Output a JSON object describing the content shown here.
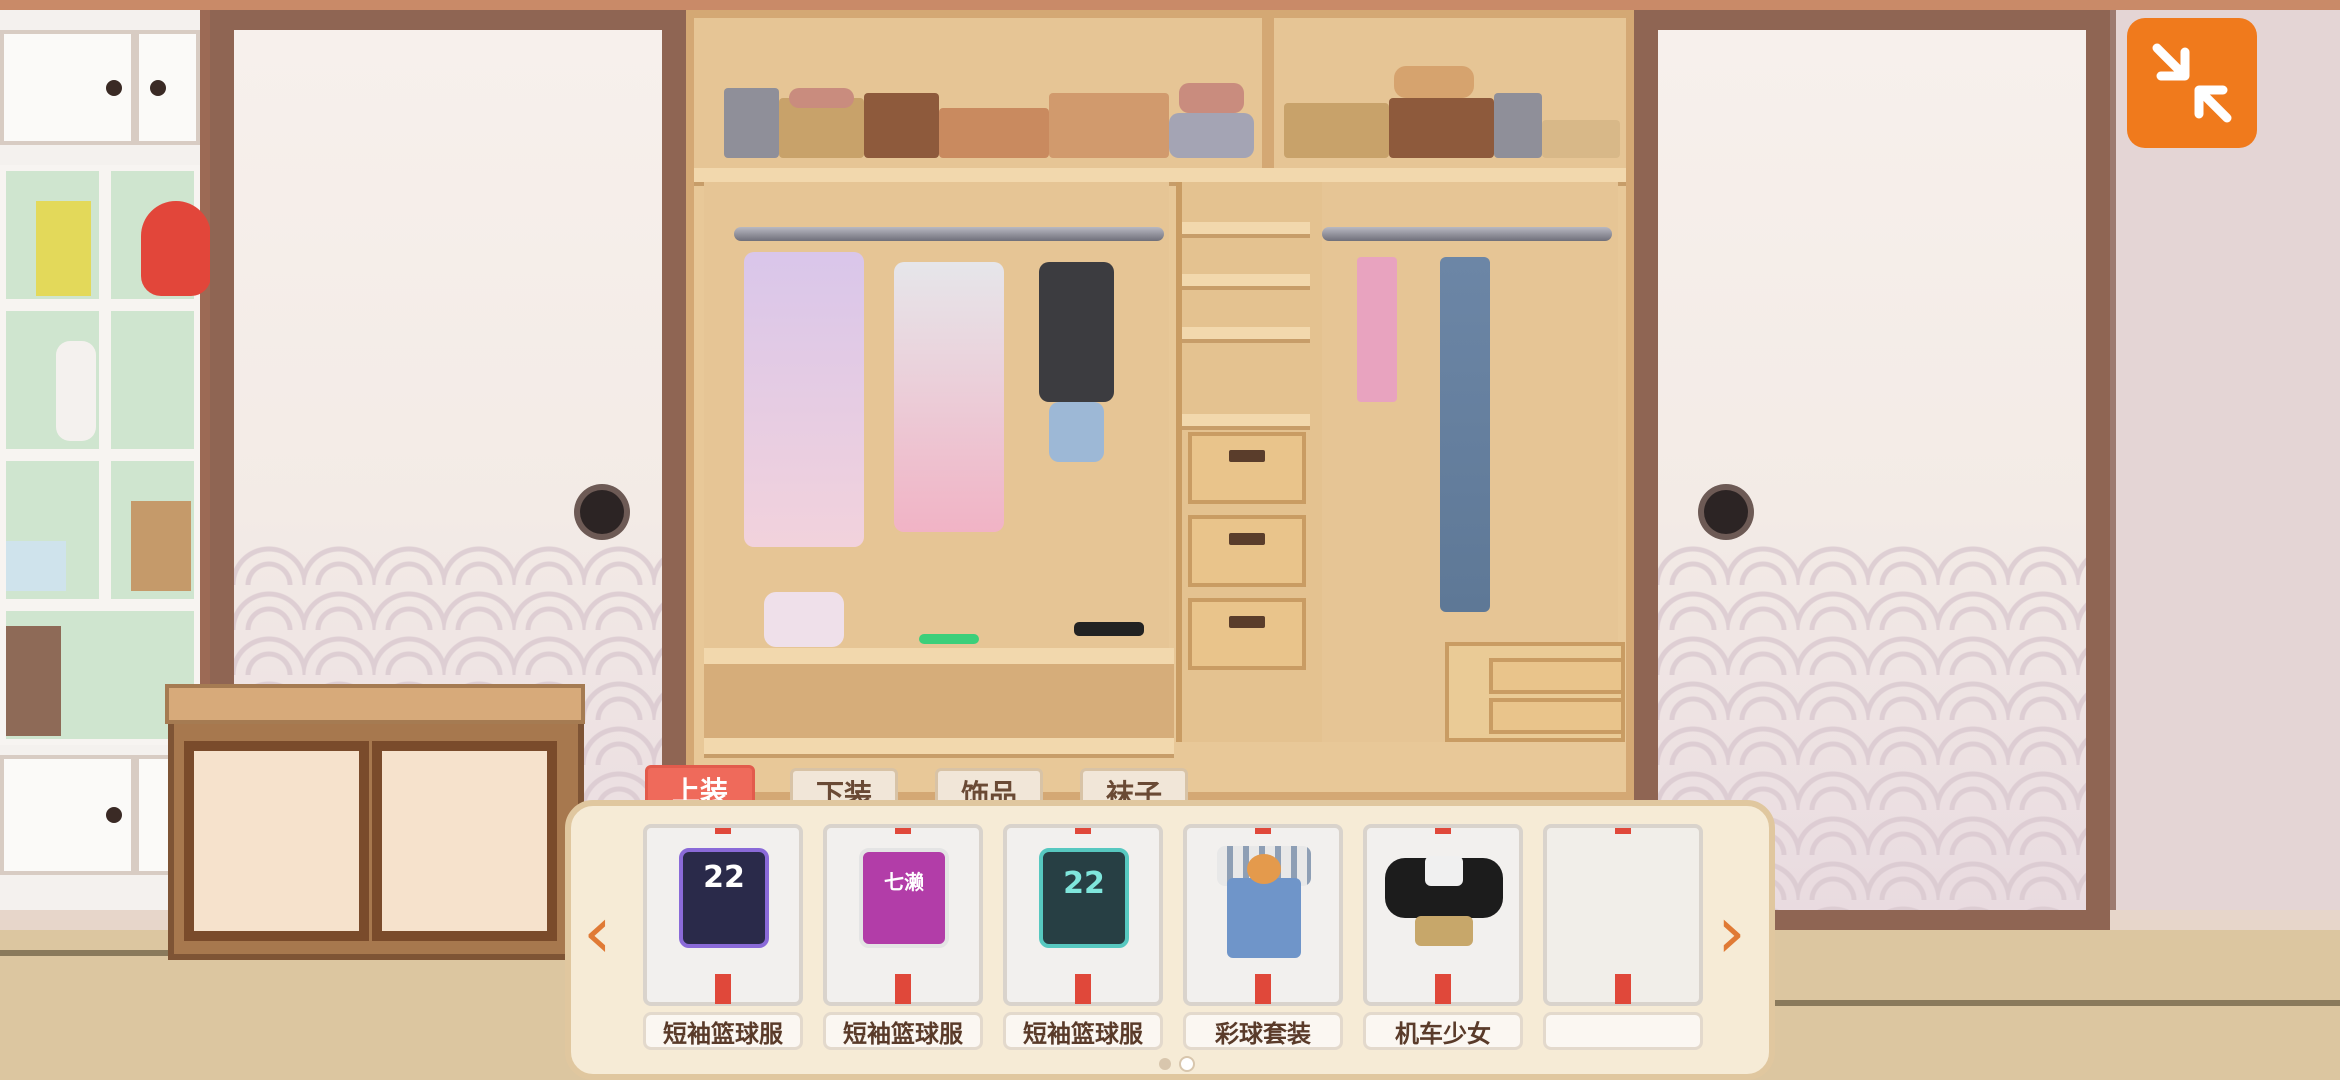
{
  "tabs": [
    {
      "label": "上装",
      "active": true
    },
    {
      "label": "下装",
      "active": false
    },
    {
      "label": "饰品",
      "active": false
    },
    {
      "label": "袜子",
      "active": false
    }
  ],
  "outfits": [
    {
      "name": "短袖篮球服",
      "icon": "jersey-purple-icon",
      "jersey_number": "22",
      "shirt_color": "#2a2a4a",
      "trim_color": "#8a6ad8"
    },
    {
      "name": "短袖篮球服",
      "icon": "jersey-magenta-icon",
      "jersey_number": "七濑",
      "shirt_color": "#b23da8",
      "trim_color": "#e4e4e4"
    },
    {
      "name": "短袖篮球服",
      "icon": "jersey-teal-icon",
      "jersey_number": "22",
      "shirt_color": "#273f44",
      "trim_color": "#57c8c0"
    },
    {
      "name": "彩球套装",
      "icon": "shiba-overalls-icon",
      "shirt_color": "#6f95c9",
      "trim_color": "#e8e8e8"
    },
    {
      "name": "机车少女",
      "icon": "biker-jacket-icon",
      "shirt_color": "#1c1c1c",
      "trim_color": "#f0f0f0"
    },
    {
      "name": "",
      "icon": "empty-slot-icon"
    }
  ],
  "pager": {
    "pages": 2,
    "current": 2
  },
  "icons": {
    "minimize": "minimize-arrows-icon",
    "prev": "chevron-left-icon",
    "next": "chevron-right-icon",
    "prev_glyph": "‹",
    "next_glyph": "›"
  },
  "colors": {
    "accent": "#f07a1c",
    "active_tab": "#ef6a5b",
    "panel": "#f6ebd6"
  }
}
